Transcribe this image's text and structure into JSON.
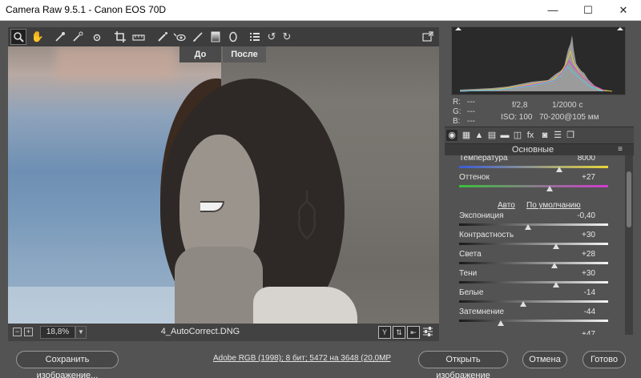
{
  "window": {
    "title": "Camera Raw 9.5.1  -  Canon EOS 70D",
    "minimize": "—",
    "maximize": "☐",
    "close": "✕"
  },
  "toolbar": {
    "tools": [
      "zoom-icon",
      "hand-icon",
      "white-balance-icon",
      "color-sampler-icon",
      "targeted-adjustment-icon",
      "crop-icon",
      "straighten-icon",
      "spot-removal-icon",
      "red-eye-icon",
      "adjustment-brush-icon",
      "graduated-filter-icon",
      "radial-filter-icon",
      "preferences-icon",
      "rotate-ccw-icon",
      "rotate-cw-icon"
    ],
    "fullscreen_icon": "fullscreen-icon"
  },
  "preview": {
    "before_label": "До",
    "after_label": "После"
  },
  "preview_bar": {
    "zoom_out": "−",
    "zoom_in": "+",
    "zoom_value": "18,8%",
    "filename": "4_AutoCorrect.DNG"
  },
  "info": {
    "r_label": "R:",
    "g_label": "G:",
    "b_label": "B:",
    "r_value": "---",
    "g_value": "---",
    "b_value": "---",
    "aperture": "f/2,8",
    "shutter": "1/2000 с",
    "iso": "ISO: 100",
    "lens": "70-200@105 мм"
  },
  "panel": {
    "title": "Основные",
    "auto_link": "Авто",
    "default_link": "По умолчанию",
    "sliders": [
      {
        "label": "Температура",
        "value": "8000",
        "fraction": 0.67,
        "track": "temp"
      },
      {
        "label": "Оттенок",
        "value": "+27",
        "fraction": 0.61,
        "track": "tint"
      },
      {
        "label": "Экспониция",
        "value": "-0,40",
        "fraction": 0.46,
        "track": "plain"
      },
      {
        "label": "Контрастность",
        "value": "+30",
        "fraction": 0.65,
        "track": "plain"
      },
      {
        "label": "Света",
        "value": "+28",
        "fraction": 0.64,
        "track": "plain"
      },
      {
        "label": "Тени",
        "value": "+30",
        "fraction": 0.65,
        "track": "plain"
      },
      {
        "label": "Белые",
        "value": "-14",
        "fraction": 0.43,
        "track": "plain"
      },
      {
        "label": "Затемнение",
        "value": "-44",
        "fraction": 0.28,
        "track": "plain"
      }
    ],
    "partial_value": "+47"
  },
  "footer": {
    "save_label": "Сохранить изображение...",
    "workflow_link": "Adobe RGB (1998); 8 бит; 5472 на 3648 (20,0MP); 300 ppi",
    "open_label": "Открыть изображение",
    "cancel_label": "Отмена",
    "done_label": "Готово"
  },
  "colors": {
    "panel_bg": "#535353",
    "dark": "#3d3d3d",
    "accent_temp_left": "#3b5bd9",
    "accent_temp_right": "#e8d53a",
    "accent_tint_left": "#39c03a",
    "accent_tint_right": "#d23bd2"
  }
}
